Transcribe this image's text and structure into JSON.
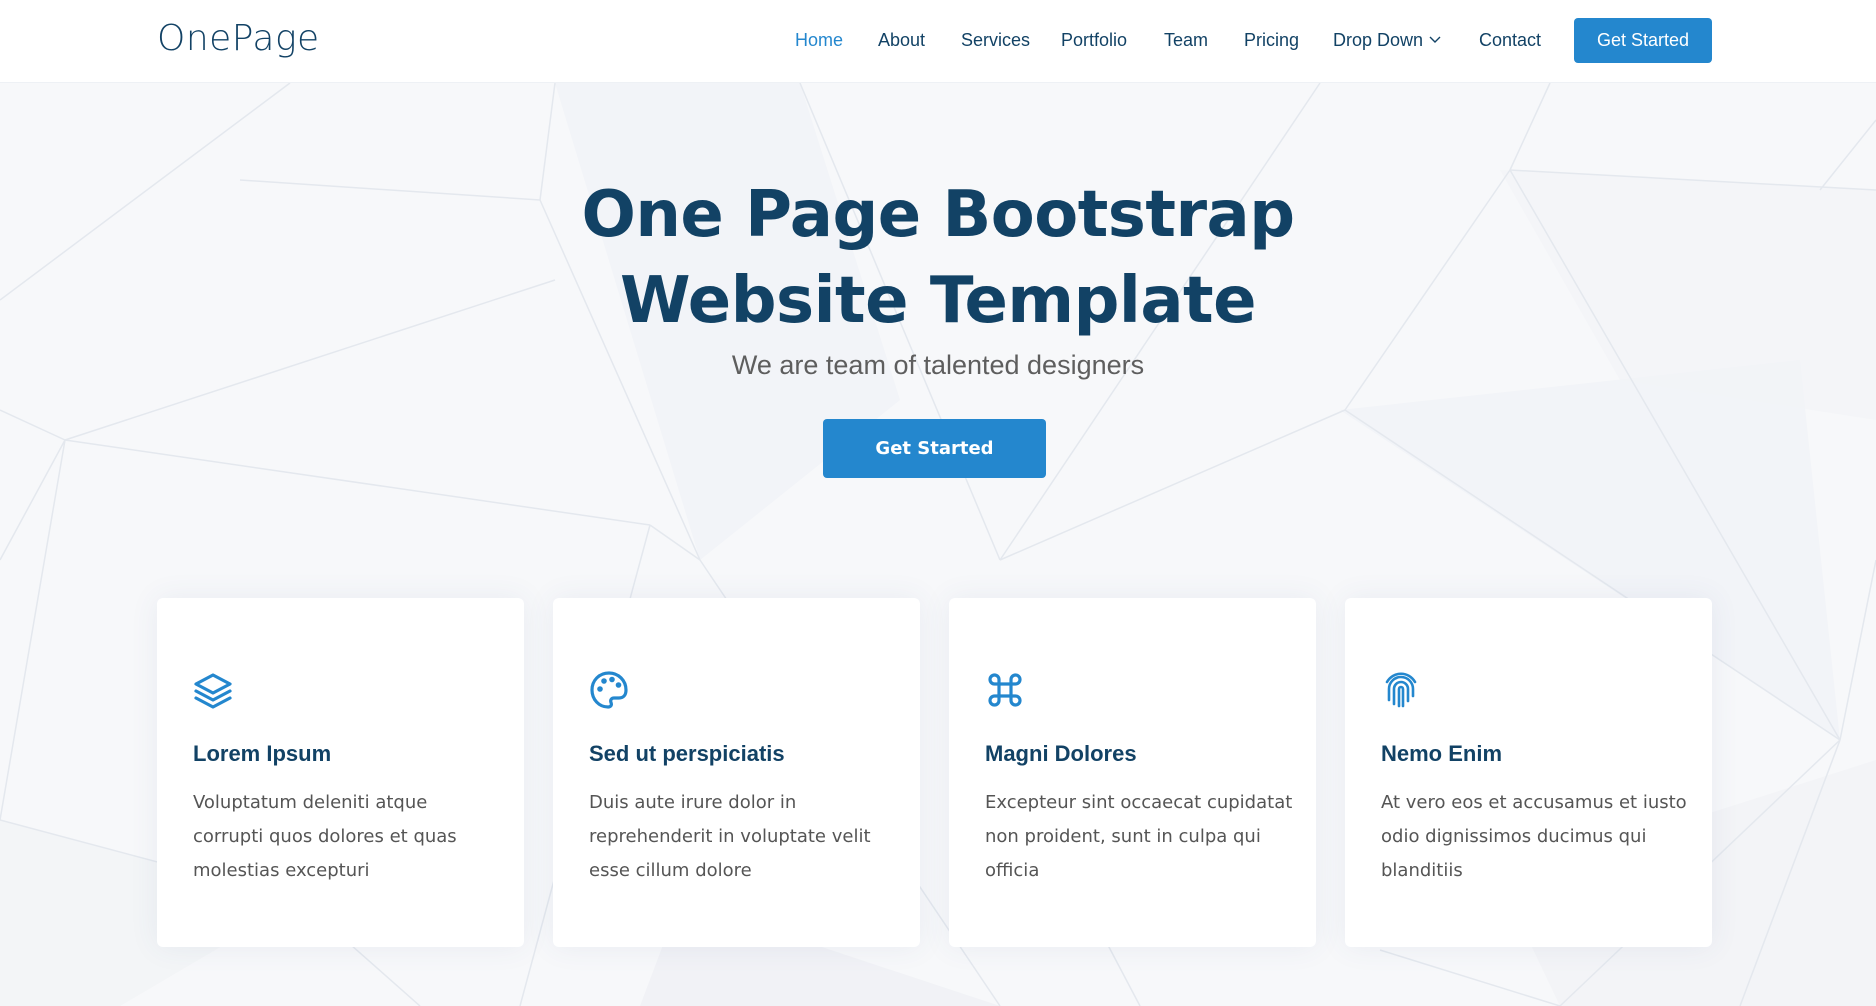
{
  "header": {
    "logo": "OnePage",
    "nav": [
      {
        "label": "Home",
        "active": true
      },
      {
        "label": "About"
      },
      {
        "label": "Services"
      },
      {
        "label": "Portfolio"
      },
      {
        "label": "Team"
      },
      {
        "label": "Pricing"
      },
      {
        "label": "Drop Down",
        "icon": "chevron-down-icon"
      },
      {
        "label": "Contact"
      }
    ],
    "cta_label": "Get Started"
  },
  "hero": {
    "title_line1": "One Page Bootstrap",
    "title_line2": "Website Template",
    "subtitle": "We are team of talented designers",
    "cta_label": "Get Started"
  },
  "features": [
    {
      "icon": "stack-layers-icon",
      "title": "Lorem Ipsum",
      "text": "Voluptatum deleniti atque corrupti quos dolores et quas molestias excepturi"
    },
    {
      "icon": "palette-icon",
      "title": "Sed ut perspiciatis",
      "text": "Duis aute irure dolor in reprehenderit in voluptate velit esse cillum dolore"
    },
    {
      "icon": "command-icon",
      "title": "Magni Dolores",
      "text": "Excepteur sint occaecat cupidatat non proident, sunt in culpa qui officia"
    },
    {
      "icon": "fingerprint-icon",
      "title": "Nemo Enim",
      "text": "At vero eos et accusamus et iusto odio dignissimos ducimus qui blanditiis"
    }
  ],
  "colors": {
    "accent": "#2487ce",
    "heading": "#124265",
    "text": "#555555"
  }
}
